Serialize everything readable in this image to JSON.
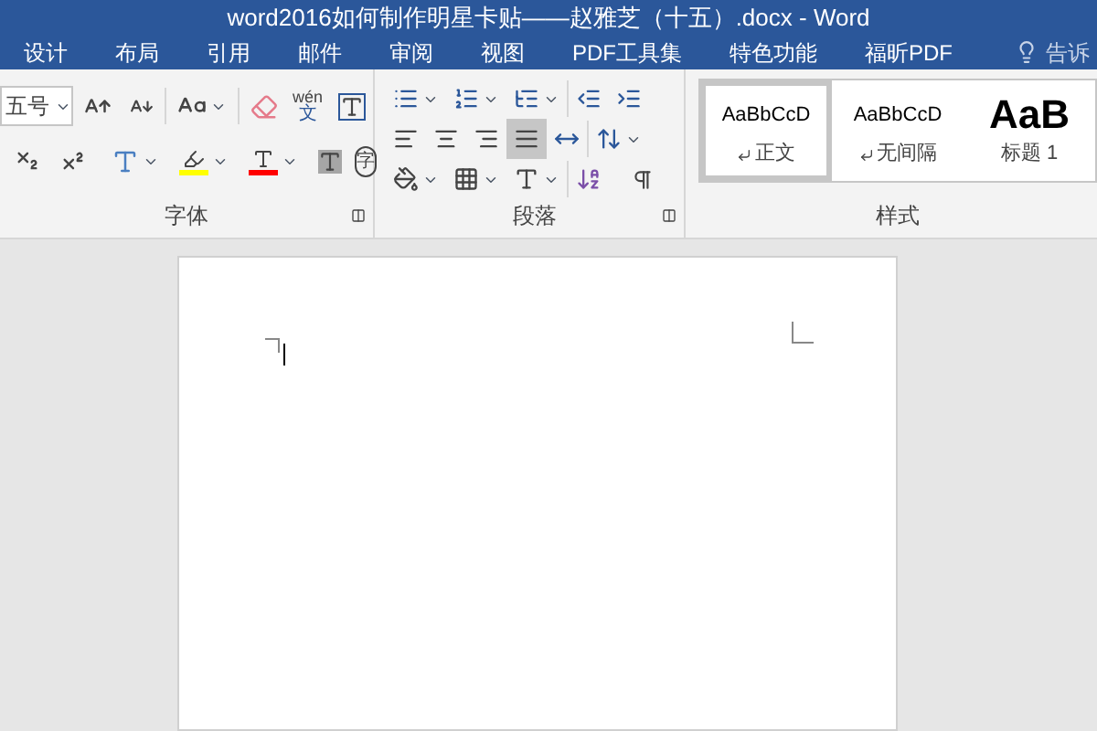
{
  "window": {
    "title": "word2016如何制作明星卡贴——赵雅芝（十五）.docx - Word"
  },
  "tabs": [
    {
      "label": "设计",
      "selected": false
    },
    {
      "label": "布局",
      "selected": false
    },
    {
      "label": "引用",
      "selected": false
    },
    {
      "label": "邮件",
      "selected": false
    },
    {
      "label": "审阅",
      "selected": false
    },
    {
      "label": "视图",
      "selected": false
    },
    {
      "label": "PDF工具集",
      "selected": false
    },
    {
      "label": "特色功能",
      "selected": false
    },
    {
      "label": "福昕PDF",
      "selected": false
    }
  ],
  "tell_me": {
    "placeholder": "告诉"
  },
  "font_group": {
    "label": "字体",
    "font_size": "五号",
    "phonetic_top": "wén",
    "phonetic_bottom": "文",
    "enclose_char": "字"
  },
  "paragraph_group": {
    "label": "段落"
  },
  "styles_group": {
    "label": "样式",
    "styles": [
      {
        "preview": "AaBbCcD",
        "name": "正文",
        "kind": "normal",
        "selected": true
      },
      {
        "preview": "AaBbCcD",
        "name": "无间隔",
        "kind": "normal",
        "selected": false
      },
      {
        "preview": "AaB",
        "name": "标题 1",
        "kind": "heading",
        "selected": false
      }
    ]
  }
}
